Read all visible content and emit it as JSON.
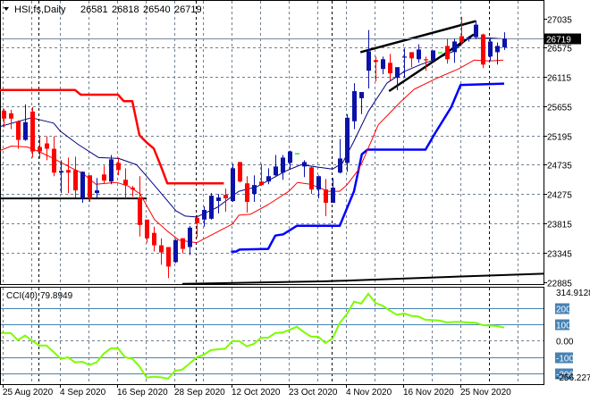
{
  "header": {
    "symbol": "HSI,fs,Daily",
    "open": "26581",
    "high": "26818",
    "low": "26540",
    "close": "26719",
    "menu_icon": "triangle-down-icon"
  },
  "colors": {
    "bull": "#0a12a8",
    "bear": "#ff0000",
    "doji": "#00e000",
    "ema_fast": "#000080",
    "ema_slow": "#ff0000",
    "stop_red": "#ff0000",
    "stop_blue": "#0000ff",
    "cci_line": "#7cfc00",
    "cci_level": "#4682b4",
    "grid": "#708090",
    "bid_line": "#778899"
  },
  "price_axis": {
    "ticks": [
      {
        "value": 27035,
        "label": "27035"
      },
      {
        "value": 26575,
        "label": "26575"
      },
      {
        "value": 26115,
        "label": "26115"
      },
      {
        "value": 25655,
        "label": "25655"
      },
      {
        "value": 25195,
        "label": "25195"
      },
      {
        "value": 24735,
        "label": "24735"
      },
      {
        "value": 24275,
        "label": "24275"
      },
      {
        "value": 23815,
        "label": "23815"
      },
      {
        "value": 23345,
        "label": "23345"
      },
      {
        "value": 22885,
        "label": "22885"
      }
    ],
    "current_price": {
      "value": 26719,
      "label": "26719"
    }
  },
  "cci": {
    "label": "CCI(40)",
    "value": "79.8949",
    "axis_max": {
      "value": 314.9128,
      "label": "314.9128"
    },
    "axis_min": {
      "value": -256.227,
      "label": "-256.227"
    },
    "levels": [
      {
        "value": 200,
        "label": "200",
        "boxed": true
      },
      {
        "value": 100,
        "label": "100",
        "boxed": true
      },
      {
        "value": 0,
        "label": "0.00",
        "boxed": false
      },
      {
        "value": -100,
        "label": "-100",
        "boxed": true
      },
      {
        "value": -200,
        "label": "-200",
        "boxed": true
      }
    ],
    "values": [
      47,
      47,
      3,
      31,
      0,
      -30,
      -30,
      -70,
      -111,
      -102,
      -133,
      -129,
      -148,
      -133,
      -80,
      -47,
      -47,
      -102,
      -111,
      -157,
      -226,
      -220,
      -224,
      -232,
      -184,
      -177,
      -140,
      -102,
      -86,
      -58,
      -53,
      -49,
      -2,
      -4,
      -35,
      -20,
      18,
      18,
      47,
      49,
      66,
      85,
      52,
      25,
      24,
      -15,
      13,
      107,
      162,
      238,
      226,
      286,
      231,
      213,
      184,
      158,
      166,
      151,
      148,
      127,
      126,
      122,
      111,
      114,
      114,
      111,
      109,
      95,
      92,
      89,
      80
    ]
  },
  "chart_data": {
    "type": "candlestick",
    "title": "HSI,fs,Daily",
    "ylim": [
      22885,
      27035
    ],
    "date_labels": [
      {
        "index": 0,
        "label": "25 Aug 2020"
      },
      {
        "index": 8,
        "label": "4 Sep 2020"
      },
      {
        "index": 16,
        "label": "16 Sep 2020"
      },
      {
        "index": 24,
        "label": "28 Sep 2020"
      },
      {
        "index": 32,
        "label": "12 Oct 2020"
      },
      {
        "index": 40,
        "label": "23 Oct 2020"
      },
      {
        "index": 48,
        "label": "4 Nov 2020"
      },
      {
        "index": 56,
        "label": "16 Nov 2020"
      },
      {
        "index": 64,
        "label": "25 Nov 2020"
      }
    ],
    "month_separators": [
      5,
      27,
      46,
      68
    ],
    "candles_ohlc": [
      [
        25585,
        25613,
        25321,
        25460
      ],
      [
        25544,
        25599,
        25293,
        25460
      ],
      [
        25418,
        25432,
        24986,
        25125
      ],
      [
        25125,
        25683,
        25111,
        25404
      ],
      [
        25572,
        25641,
        24847,
        24944
      ],
      [
        25014,
        25181,
        24833,
        24944
      ],
      [
        25070,
        25181,
        24805,
        24986
      ],
      [
        24986,
        25181,
        24554,
        24610
      ],
      [
        24610,
        24805,
        24289,
        24637
      ],
      [
        24651,
        24847,
        24289,
        24610
      ],
      [
        24651,
        24861,
        24219,
        24331
      ],
      [
        24219,
        24630,
        24136,
        24624
      ],
      [
        24568,
        24568,
        24150,
        24205
      ],
      [
        24289,
        24526,
        24205,
        24331
      ],
      [
        24582,
        24721,
        24442,
        24484
      ],
      [
        24470,
        24888,
        24428,
        24819
      ],
      [
        24763,
        24847,
        24568,
        24651
      ],
      [
        24498,
        24679,
        24205,
        24415
      ],
      [
        24373,
        24401,
        24233,
        24345
      ],
      [
        24219,
        24554,
        23606,
        23787
      ],
      [
        23871,
        23871,
        23508,
        23578
      ],
      [
        23662,
        23759,
        23369,
        23467
      ],
      [
        23467,
        23578,
        23160,
        23355
      ],
      [
        23439,
        23439,
        22951,
        23132
      ],
      [
        23202,
        23564,
        23188,
        23550
      ],
      [
        23578,
        23578,
        23341,
        23411
      ],
      [
        23439,
        23773,
        23313,
        23745
      ],
      [
        23899,
        23941,
        23592,
        23815
      ],
      [
        23871,
        24080,
        23759,
        24024
      ],
      [
        23885,
        24289,
        23871,
        24247
      ],
      [
        24164,
        24275,
        23968,
        24219
      ],
      [
        24261,
        24359,
        23996,
        24205
      ],
      [
        24164,
        24749,
        24150,
        24679
      ],
      [
        24777,
        24777,
        24456,
        24470
      ],
      [
        24442,
        24554,
        23982,
        24150
      ],
      [
        24275,
        24568,
        24150,
        24415
      ],
      [
        24470,
        24749,
        24401,
        24415
      ],
      [
        24470,
        24679,
        24428,
        24554
      ],
      [
        24568,
        24888,
        24540,
        24707
      ],
      [
        24610,
        24888,
        24498,
        24847
      ],
      [
        24763,
        24958,
        24665,
        24944
      ],
      [
        24916,
        24916,
        24916,
        24916
      ],
      [
        24707,
        24805,
        24540,
        24777
      ],
      [
        24693,
        24707,
        24275,
        24345
      ],
      [
        24345,
        24568,
        24205,
        24554
      ],
      [
        24345,
        24512,
        23927,
        24136
      ],
      [
        24136,
        24526,
        24136,
        24373
      ],
      [
        24610,
        25139,
        24596,
        24833
      ],
      [
        24763,
        25530,
        24624,
        25474
      ],
      [
        25418,
        26018,
        25293,
        25892
      ],
      [
        25781,
        25878,
        25530,
        25878
      ],
      [
        26213,
        26854,
        25934,
        26519
      ],
      [
        26380,
        26436,
        26045,
        26352
      ],
      [
        26241,
        26436,
        26157,
        26394
      ],
      [
        26338,
        26478,
        26059,
        26171
      ],
      [
        26101,
        26269,
        25906,
        26269
      ],
      [
        26422,
        26561,
        26101,
        26436
      ],
      [
        26505,
        26505,
        26269,
        26408
      ],
      [
        26394,
        26631,
        26338,
        26547
      ],
      [
        26394,
        26436,
        26213,
        26380
      ],
      [
        26380,
        26533,
        26366,
        26533
      ],
      [
        26505,
        26505,
        26505,
        26505
      ],
      [
        26603,
        26715,
        26324,
        26394
      ],
      [
        26505,
        26715,
        26338,
        26673
      ],
      [
        26756,
        27063,
        26617,
        26659
      ],
      [
        26715,
        26756,
        26673,
        26729
      ],
      [
        26742,
        27007,
        26715,
        26938
      ],
      [
        26784,
        26798,
        26255,
        26310
      ],
      [
        26436,
        26729,
        26366,
        26673
      ],
      [
        26505,
        26659,
        26310,
        26603
      ],
      [
        26581,
        26818,
        26540,
        26719
      ]
    ],
    "ma_fast": [
      [
        -0.5,
        25335
      ],
      [
        3.9,
        25474
      ],
      [
        7,
        25390
      ],
      [
        7.9,
        25265
      ],
      [
        10.4,
        25056
      ],
      [
        13.3,
        24847
      ],
      [
        16.1,
        24833
      ],
      [
        18.6,
        24735
      ],
      [
        19.9,
        24567
      ],
      [
        22,
        24289
      ],
      [
        24.1,
        24010
      ],
      [
        25.4,
        23926
      ],
      [
        27,
        23912
      ],
      [
        29.9,
        24066
      ],
      [
        32.9,
        24317
      ],
      [
        35.4,
        24387
      ],
      [
        37,
        24484
      ],
      [
        39.5,
        24638
      ],
      [
        41.6,
        24735
      ],
      [
        44.1,
        24693
      ],
      [
        46,
        24665
      ],
      [
        47.4,
        24763
      ],
      [
        48.9,
        25084
      ],
      [
        51,
        25572
      ],
      [
        53.6,
        26018
      ],
      [
        56,
        26199
      ],
      [
        58.3,
        26310
      ],
      [
        60.8,
        26408
      ],
      [
        62.9,
        26519
      ],
      [
        64.9,
        26715
      ],
      [
        67.9,
        26729
      ],
      [
        69.8,
        26715
      ]
    ],
    "ma_slow": [
      [
        -0.5,
        24958
      ],
      [
        1.1,
        25028
      ],
      [
        3.3,
        25014
      ],
      [
        4.9,
        24944
      ],
      [
        7,
        24833
      ],
      [
        9.1,
        24707
      ],
      [
        11.1,
        24596
      ],
      [
        12.9,
        24428
      ],
      [
        15.8,
        24456
      ],
      [
        17.4,
        24401
      ],
      [
        19.1,
        24275
      ],
      [
        21.1,
        23871
      ],
      [
        22.9,
        23690
      ],
      [
        24.5,
        23550
      ],
      [
        27,
        23508
      ],
      [
        32,
        23801
      ],
      [
        32.9,
        23941
      ],
      [
        34.5,
        23955
      ],
      [
        37,
        24108
      ],
      [
        39.9,
        24317
      ],
      [
        41.1,
        24456
      ],
      [
        42.9,
        24428
      ],
      [
        45.4,
        24317
      ],
      [
        47,
        24317
      ],
      [
        48,
        24415
      ],
      [
        49.5,
        24637
      ],
      [
        50.1,
        24763
      ],
      [
        52.4,
        25362
      ],
      [
        55.4,
        25711
      ],
      [
        57.4,
        25920
      ],
      [
        60.4,
        26087
      ],
      [
        63.6,
        26241
      ],
      [
        65.8,
        26380
      ],
      [
        67.9,
        26366
      ],
      [
        69.9,
        26380
      ]
    ],
    "stop_red": [
      [
        -0.5,
        25910
      ],
      [
        10,
        25910
      ],
      [
        10.8,
        25836
      ],
      [
        16,
        25836
      ],
      [
        16.8,
        25735
      ],
      [
        18,
        25735
      ],
      [
        19,
        25198
      ],
      [
        20,
        25084
      ],
      [
        21,
        24990
      ],
      [
        22,
        24712
      ],
      [
        22.9,
        24442
      ],
      [
        30.8,
        24442
      ]
    ],
    "stop_blue": [
      [
        31.8,
        23369
      ],
      [
        32.5,
        23369
      ],
      [
        33,
        23400
      ],
      [
        37,
        23411
      ],
      [
        38,
        23620
      ],
      [
        39.1,
        23640
      ],
      [
        41,
        23773
      ],
      [
        47,
        23773
      ],
      [
        49,
        24317
      ],
      [
        50.1,
        24900
      ],
      [
        50.9,
        24972
      ],
      [
        59,
        24972
      ],
      [
        60.3,
        25223
      ],
      [
        62.6,
        25641
      ],
      [
        63.9,
        25990
      ],
      [
        70,
        26010
      ]
    ],
    "ma_long": [
      [
        25,
        22860
      ],
      [
        45,
        22900
      ],
      [
        70,
        23000
      ],
      [
        75.5,
        23020
      ]
    ],
    "support_level": {
      "value": 24205,
      "from": -0.5,
      "to": 20
    },
    "trendlines": [
      [
        [
          49.9,
          26505
        ],
        [
          66,
          26993
        ]
      ],
      [
        [
          53.9,
          25892
        ],
        [
          65.75,
          26784
        ]
      ]
    ]
  }
}
